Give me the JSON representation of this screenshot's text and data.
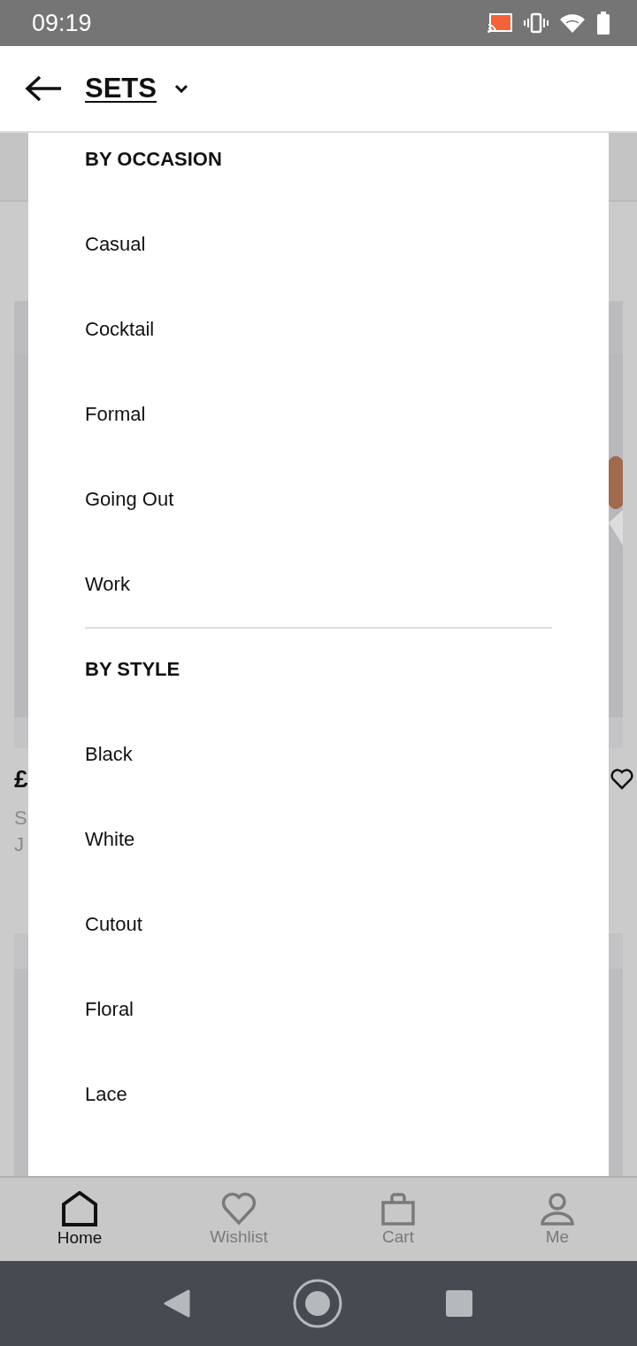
{
  "status_bar": {
    "time": "09:19"
  },
  "header": {
    "title": "SETS"
  },
  "background": {
    "product": {
      "price": "£",
      "name_lines": [
        "S",
        "J"
      ]
    }
  },
  "dropdown": {
    "sections": [
      {
        "heading": "BY OCCASION",
        "items": [
          "Casual",
          "Cocktail",
          "Formal",
          "Going Out",
          "Work"
        ]
      },
      {
        "heading": "BY STYLE",
        "items": [
          "Black",
          "White",
          "Cutout",
          "Floral",
          "Lace"
        ]
      }
    ]
  },
  "bottom_nav": [
    {
      "label": "Home",
      "selected": true
    },
    {
      "label": "Wishlist",
      "selected": false
    },
    {
      "label": "Cart",
      "selected": false
    },
    {
      "label": "Me",
      "selected": false
    }
  ]
}
